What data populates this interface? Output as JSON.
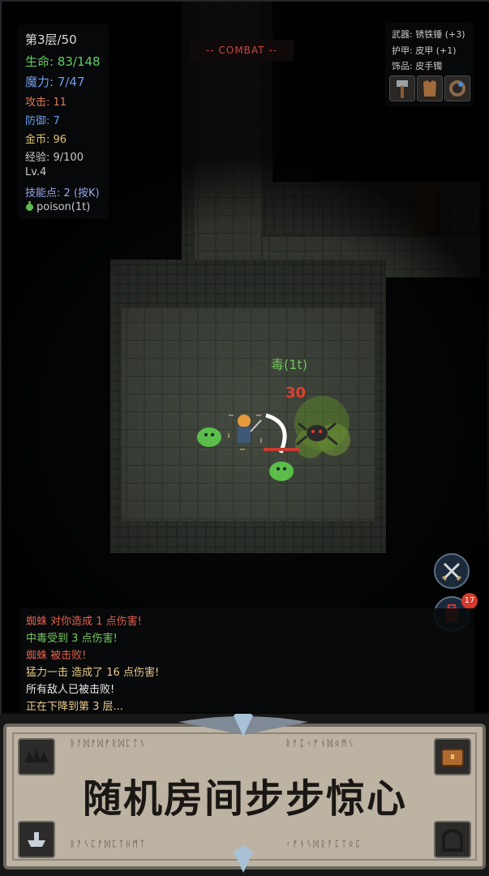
{
  "stats": {
    "floor": "第3层/50",
    "hp": "生命: 83/148",
    "mp": "魔力: 7/47",
    "atk": "攻击: 11",
    "def": "防御: 7",
    "gold": "金币: 96",
    "exp": "经验: 9/100",
    "level": "Lv.4",
    "skill_points": "技能点: 2 (按K)",
    "status_effect": "poison(1t)"
  },
  "equipment": {
    "weapon": "武器: 锈铁锤 (+3)",
    "armor": "护甲: 皮甲 (+1)",
    "accessory": "饰品: 皮手镯",
    "slot_icons": [
      "hammer-icon",
      "leather-armor-icon",
      "bracelet-icon"
    ]
  },
  "combat_label": "-- COMBAT --",
  "floating_text": {
    "poison": "毒(1t)",
    "damage": "30"
  },
  "buttons": {
    "inventory_badge": "17"
  },
  "log": [
    {
      "text": "蜘蛛 对你造成 1 点伤害!",
      "color": "#e0614f"
    },
    {
      "text": "中毒受到 3 点伤害!",
      "color": "#78c860"
    },
    {
      "text": "蜘蛛 被击败!",
      "color": "#e0614f"
    },
    {
      "text": "猛力一击 造成了 16 点伤害!",
      "color": "#e8c98a"
    },
    {
      "text": "所有敌人已被击败!",
      "color": "#e8e8e8"
    },
    {
      "text": "正在下降到第 3 层...",
      "color": "#e8c98a"
    }
  ],
  "banner": {
    "slogan": "随机房间步步惊心",
    "runes_top_left": "ᚱᚨᛞᚠᛞᚠᚱᛞᛈᛏᛊ",
    "runes_top_right": "ᚱᚨᛈᚲᚠᚾᛞᛟᛗᛊ",
    "runes_bottom_left": "ᚱᚨᛊᛈᚠᛞᛈᛏᚺᛗᛏ",
    "runes_bottom_right": "ᚲᚠᚾᛊᛞᚱᚨᛈᛏᛟᛈ"
  },
  "colors": {
    "floor_label": "#dcdcdc",
    "hp": "#5fcf62",
    "mp": "#6e9ce8",
    "atk": "#e07a5a",
    "def": "#6e9ce8",
    "gold": "#e0c46a",
    "exp": "#c9c9c9",
    "level": "#c9c9c9",
    "skill": "#9aa6e8"
  }
}
